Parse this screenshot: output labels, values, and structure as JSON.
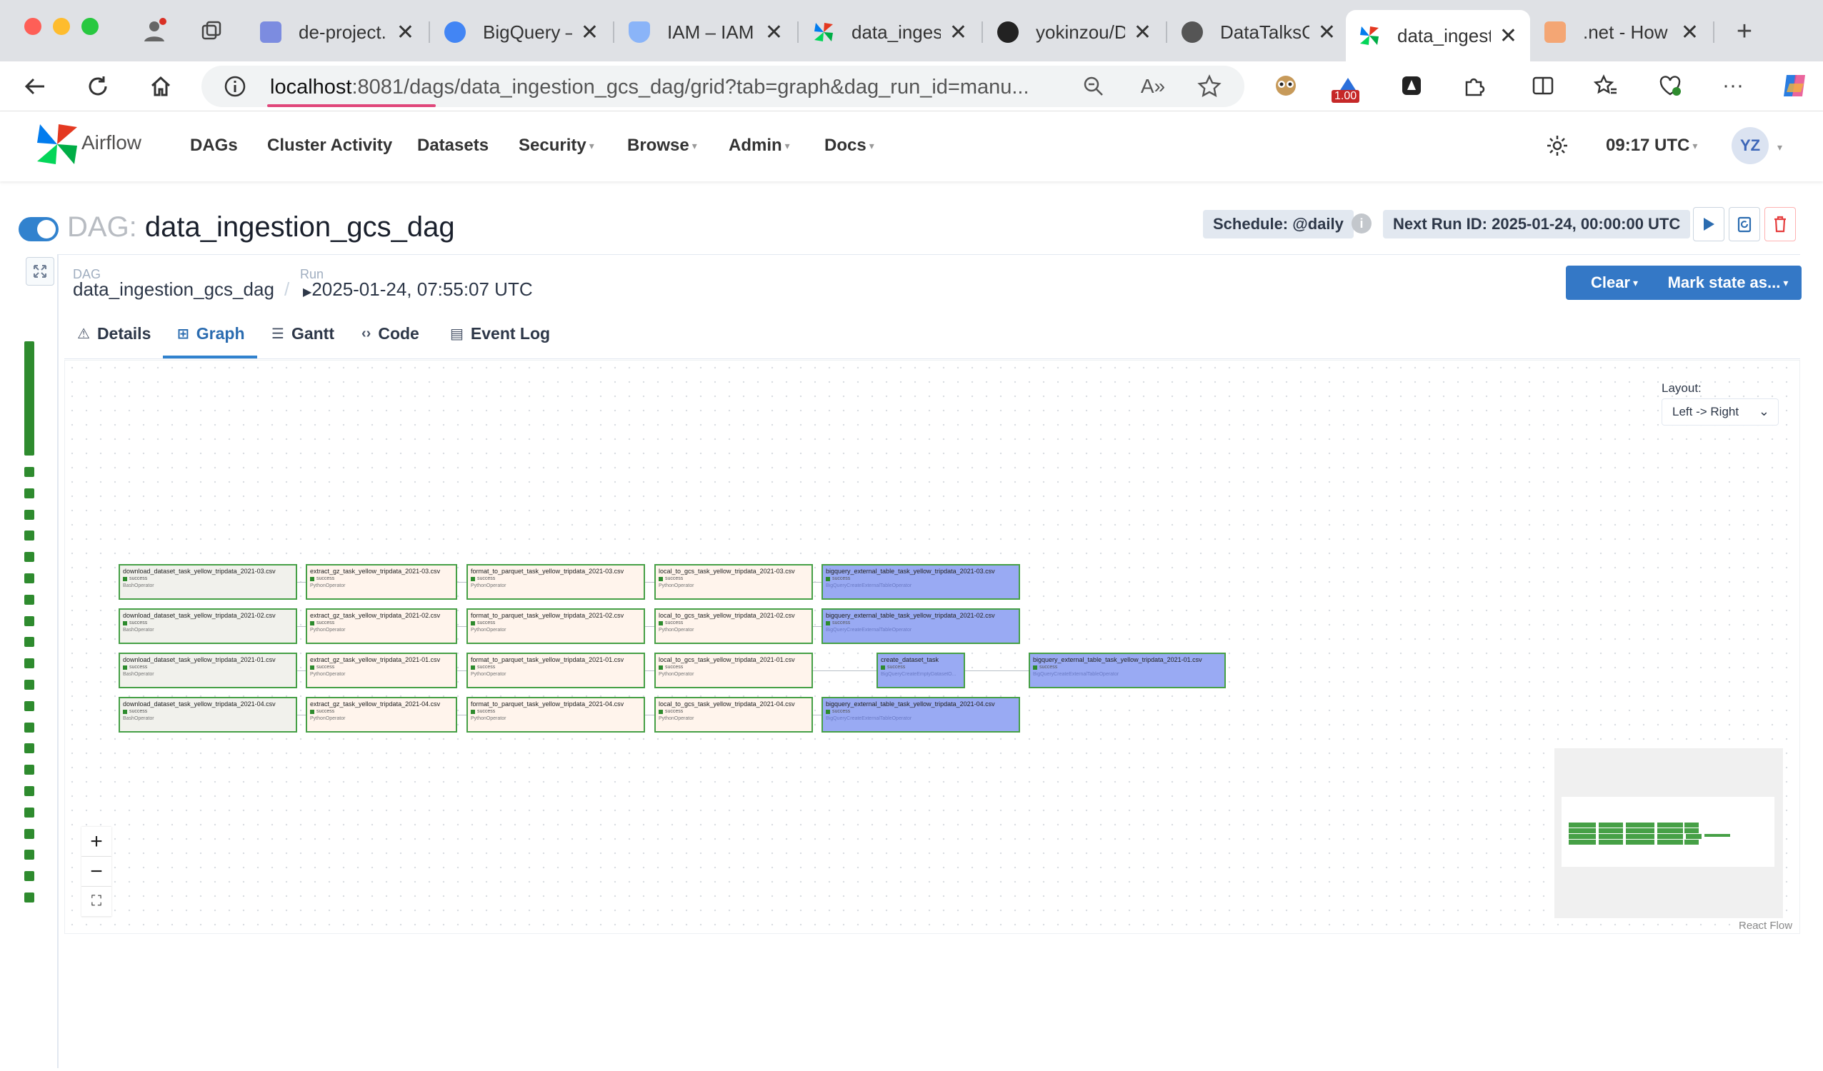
{
  "browser": {
    "tabs": [
      {
        "title": "de-project...",
        "favicon_color": "#7c8ce0"
      },
      {
        "title": "BigQuery – ...",
        "favicon_color": "#4285f4"
      },
      {
        "title": "IAM – IAM & ...",
        "favicon_color": "#8ab4f8"
      },
      {
        "title": "data_ingest...",
        "favicon_color": "#e43921"
      },
      {
        "title": "yokinzou/D...",
        "favicon_color": "#222222"
      },
      {
        "title": "DataTalksCl...",
        "favicon_color": "#555555"
      },
      {
        "title": "data_ingest...",
        "favicon_color": "#e43921"
      },
      {
        "title": ".net - How ...",
        "favicon_color": "#f48024"
      }
    ],
    "url_host": "localhost",
    "url_rest": ":8081/dags/data_ingestion_gcs_dag/grid?tab=graph&dag_run_id=manu...",
    "extension_badge": "1.00"
  },
  "airflow": {
    "brand": "Airflow",
    "menu": [
      "DAGs",
      "Cluster Activity",
      "Datasets",
      "Security",
      "Browse",
      "Admin",
      "Docs"
    ],
    "time": "09:17 UTC",
    "user_initials": "YZ"
  },
  "dag": {
    "prefix": "DAG:",
    "name": "data_ingestion_gcs_dag",
    "schedule": "Schedule: @daily",
    "next_run": "Next Run ID: 2025-01-24, 00:00:00 UTC"
  },
  "breadcrumb": {
    "dag_label": "DAG",
    "dag_value": "data_ingestion_gcs_dag",
    "run_label": "Run",
    "run_value": "2025-01-24, 07:55:07 UTC"
  },
  "actions": {
    "clear": "Clear",
    "mark_state": "Mark state as..."
  },
  "tabs": [
    "Details",
    "Graph",
    "Gantt",
    "Code",
    "Event Log"
  ],
  "layout": {
    "label": "Layout:",
    "value": "Left -> Right"
  },
  "graph": {
    "status": "success",
    "nodes": {
      "r1": [
        "download_dataset_task_yellow_tripdata_2021-03.csv",
        "extract_gz_task_yellow_tripdata_2021-03.csv",
        "format_to_parquet_task_yellow_tripdata_2021-03.csv",
        "local_to_gcs_task_yellow_tripdata_2021-03.csv",
        "bigquery_external_table_task_yellow_tripdata_2021-03.csv"
      ],
      "r2": [
        "download_dataset_task_yellow_tripdata_2021-02.csv",
        "extract_gz_task_yellow_tripdata_2021-02.csv",
        "format_to_parquet_task_yellow_tripdata_2021-02.csv",
        "local_to_gcs_task_yellow_tripdata_2021-02.csv",
        "bigquery_external_table_task_yellow_tripdata_2021-02.csv"
      ],
      "r3": [
        "download_dataset_task_yellow_tripdata_2021-01.csv",
        "extract_gz_task_yellow_tripdata_2021-01.csv",
        "format_to_parquet_task_yellow_tripdata_2021-01.csv",
        "local_to_gcs_task_yellow_tripdata_2021-01.csv",
        "create_dataset_task",
        "bigquery_external_table_task_yellow_tripdata_2021-01.csv"
      ],
      "r4": [
        "download_dataset_task_yellow_tripdata_2021-04.csv",
        "extract_gz_task_yellow_tripdata_2021-04.csv",
        "format_to_parquet_task_yellow_tripdata_2021-04.csv",
        "local_to_gcs_task_yellow_tripdata_2021-04.csv",
        "bigquery_external_table_task_yellow_tripdata_2021-04.csv"
      ]
    },
    "operators": {
      "bash": "BashOperator",
      "python": "PythonOperator",
      "bq_ext": "BigQueryCreateExternalTableOperator",
      "bq_ds": "BigQueryCreateEmptyDatasetO..."
    }
  },
  "react_flow": "React Flow"
}
